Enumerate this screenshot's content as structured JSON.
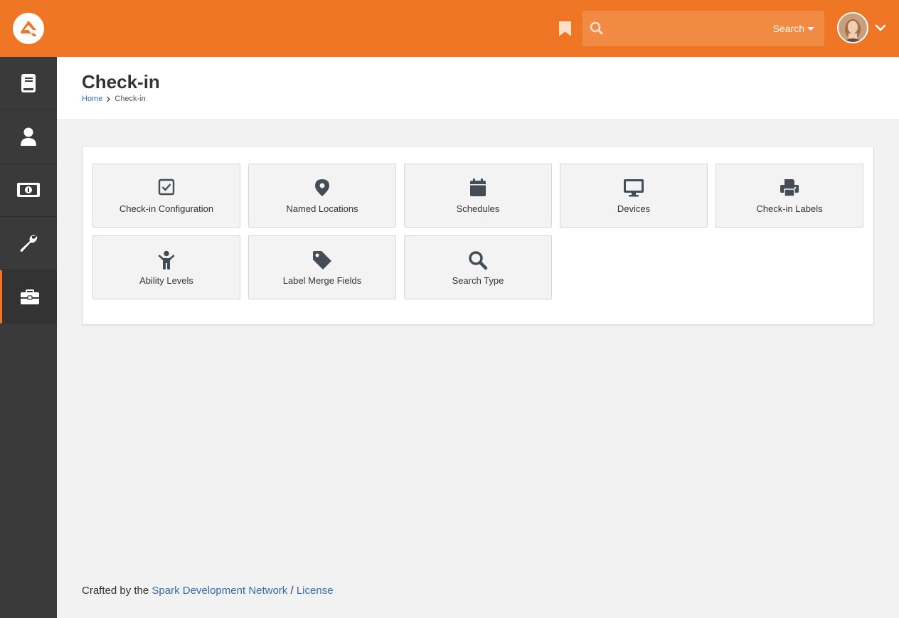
{
  "header": {
    "search": {
      "placeholder": "",
      "type_label": "Search"
    },
    "colors": {
      "brand": "#ee7624",
      "sidebar": "#3a3a3a",
      "link": "#2f6eb5"
    },
    "icons": {
      "logo": "rock-logo-icon",
      "bookmark": "bookmark-icon",
      "search": "search-icon",
      "user_menu": "chevron-down-icon"
    }
  },
  "sidebar": {
    "items": [
      {
        "icon": "book-icon"
      },
      {
        "icon": "person-icon"
      },
      {
        "icon": "money-icon"
      },
      {
        "icon": "wrench-icon"
      },
      {
        "icon": "briefcase-icon",
        "active": true
      }
    ]
  },
  "page": {
    "title": "Check-in",
    "breadcrumb": {
      "home": "Home",
      "current": "Check-in"
    }
  },
  "tiles": [
    {
      "label": "Check-in Configuration",
      "icon": "check-square-icon"
    },
    {
      "label": "Named Locations",
      "icon": "map-marker-icon"
    },
    {
      "label": "Schedules",
      "icon": "calendar-icon"
    },
    {
      "label": "Devices",
      "icon": "desktop-icon"
    },
    {
      "label": "Check-in Labels",
      "icon": "print-icon"
    },
    {
      "label": "Ability Levels",
      "icon": "child-icon"
    },
    {
      "label": "Label Merge Fields",
      "icon": "tag-icon"
    },
    {
      "label": "Search Type",
      "icon": "search-icon"
    }
  ],
  "footer": {
    "prefix": "Crafted by the ",
    "spark_link": "Spark Development Network",
    "separator": " / ",
    "license_link": "License"
  }
}
